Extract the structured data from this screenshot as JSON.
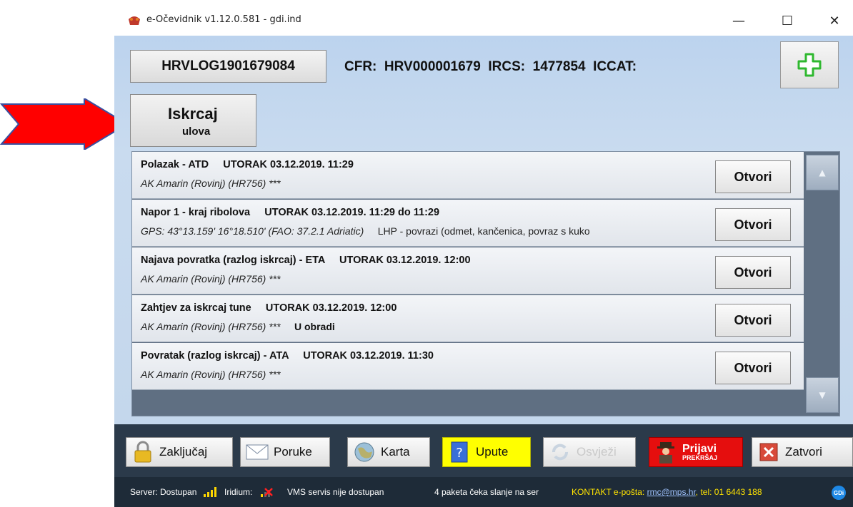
{
  "window": {
    "title": "e-Očevidnik v1.12.0.581 - gdi.ind",
    "minimize": "—",
    "maximize": "☐",
    "close": "✕"
  },
  "header": {
    "log_button": "HRVLOG1901679084",
    "cfr_info": "CFR:  HRV000001679  IRCS:  1477854  ICCAT:",
    "iskrcaj_line1": "Iskrcaj",
    "iskrcaj_line2": "ulova"
  },
  "entries": [
    {
      "title": "Polazak - ATD",
      "date": "UTORAK 03.12.2019. 11:29",
      "detail": "AK Amarin (Rovinj) (HR756) ***",
      "extra": "",
      "status": "",
      "button": "Otvori"
    },
    {
      "title": "Napor 1 - kraj ribolova",
      "date": "UTORAK 03.12.2019. 11:29 do 11:29",
      "detail": "GPS: 43°13.159' 16°18.510' (FAO: 37.2.1 Adriatic)",
      "extra": "LHP - povrazi (odmet, kančenica, povraz s kuko",
      "status": "",
      "button": "Otvori"
    },
    {
      "title": "Najava povratka (razlog iskrcaj) - ETA",
      "date": "UTORAK 03.12.2019. 12:00",
      "detail": "AK Amarin (Rovinj) (HR756) ***",
      "extra": "",
      "status": "",
      "button": "Otvori"
    },
    {
      "title": "Zahtjev za iskrcaj tune",
      "date": "UTORAK 03.12.2019. 12:00",
      "detail": "AK Amarin (Rovinj) (HR756) ***",
      "extra": "",
      "status": "U obradi",
      "button": "Otvori"
    },
    {
      "title": "Povratak (razlog iskrcaj) - ATA",
      "date": "UTORAK 03.12.2019. 11:30",
      "detail": "AK Amarin (Rovinj) (HR756) ***",
      "extra": "",
      "status": "",
      "button": "Otvori"
    }
  ],
  "toolbar": {
    "lock": "Zaključaj",
    "messages": "Poruke",
    "map": "Karta",
    "help": "Upute",
    "refresh": "Osvježi",
    "report_main": "Prijavi",
    "report_sub": "PREKRŠAJ",
    "close": "Zatvori"
  },
  "status": {
    "server": "Server: Dostupan",
    "iridium": "Iridium:",
    "vms": "VMS servis nije dostupan",
    "queue": "4 paketa čeka slanje na ser",
    "contact_prefix": "KONTAKT e-pošta: ",
    "contact_email": "rmc@mps.hr",
    "contact_suffix": ", tel: 01 6443 188",
    "gdi": "GDi"
  },
  "colors": {
    "header_bg": "#c4d7ec",
    "list_bg": "#5f6f82",
    "toolbar_bg": "#2b3a4a",
    "status_bg": "#1e2b38",
    "help_yellow": "#ffff00",
    "report_red": "#e50e0e",
    "plus_green": "#2fb82f",
    "arrow_red": "#ff0000"
  }
}
